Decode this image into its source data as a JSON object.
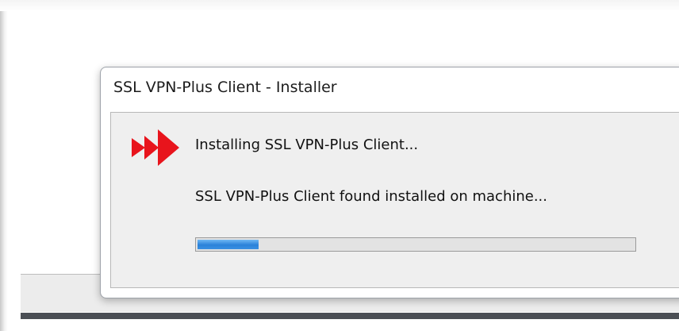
{
  "window": {
    "title": "SSL VPN-Plus Client - Installer"
  },
  "status": {
    "primary": "Installing SSL VPN-Plus Client...",
    "secondary": "SSL VPN-Plus Client found installed on machine...",
    "icon": "red-triple-arrow-icon"
  },
  "progress": {
    "fraction": 0.14
  },
  "colors": {
    "arrow_red": "#e8141c",
    "progress_blue": "#2b82d9"
  }
}
